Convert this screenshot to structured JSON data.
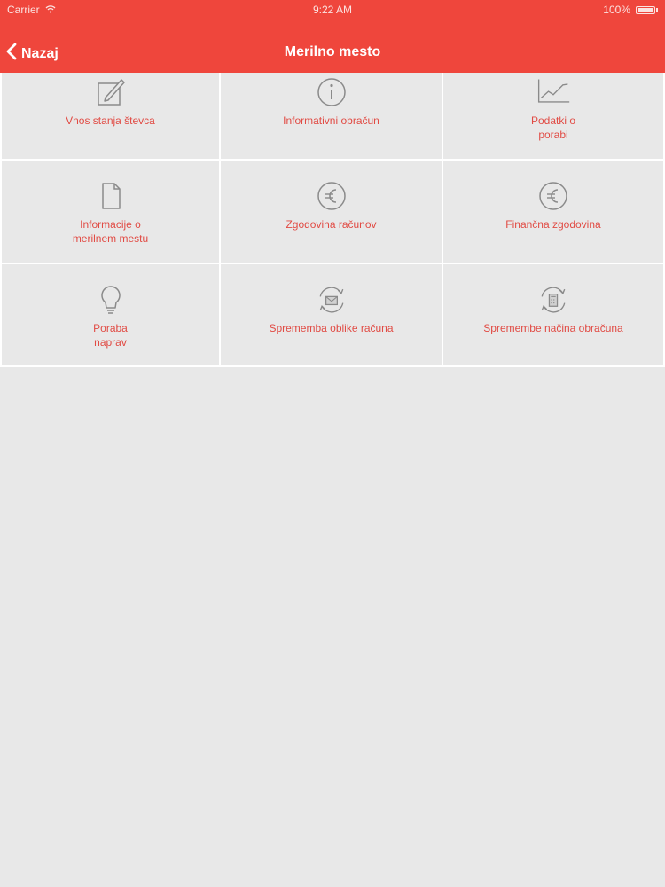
{
  "status_bar": {
    "carrier": "Carrier",
    "time": "9:22 AM",
    "battery": "100%"
  },
  "nav": {
    "back_label": "Nazaj",
    "title": "Merilno mesto"
  },
  "colors": {
    "accent": "#ef463c",
    "label": "#e14b44",
    "icon": "#8a8a8a",
    "background": "#e8e8e8"
  },
  "tiles": [
    {
      "label": "Vnos stanja števca",
      "icon": "edit-icon"
    },
    {
      "label": "Informativni obračun",
      "icon": "info-icon"
    },
    {
      "label": "Podatki o\nporabi",
      "icon": "chart-icon"
    },
    {
      "label": "Informacije o\nmerilnem mestu",
      "icon": "document-icon"
    },
    {
      "label": "Zgodovina računov",
      "icon": "euro-icon"
    },
    {
      "label": "Finančna zgodovina",
      "icon": "euro-icon"
    },
    {
      "label": "Poraba\nnaprav",
      "icon": "lightbulb-icon"
    },
    {
      "label": "Sprememba oblike računa",
      "icon": "envelope-refresh-icon"
    },
    {
      "label": "Spremembe načina obračuna",
      "icon": "calculator-refresh-icon"
    }
  ]
}
